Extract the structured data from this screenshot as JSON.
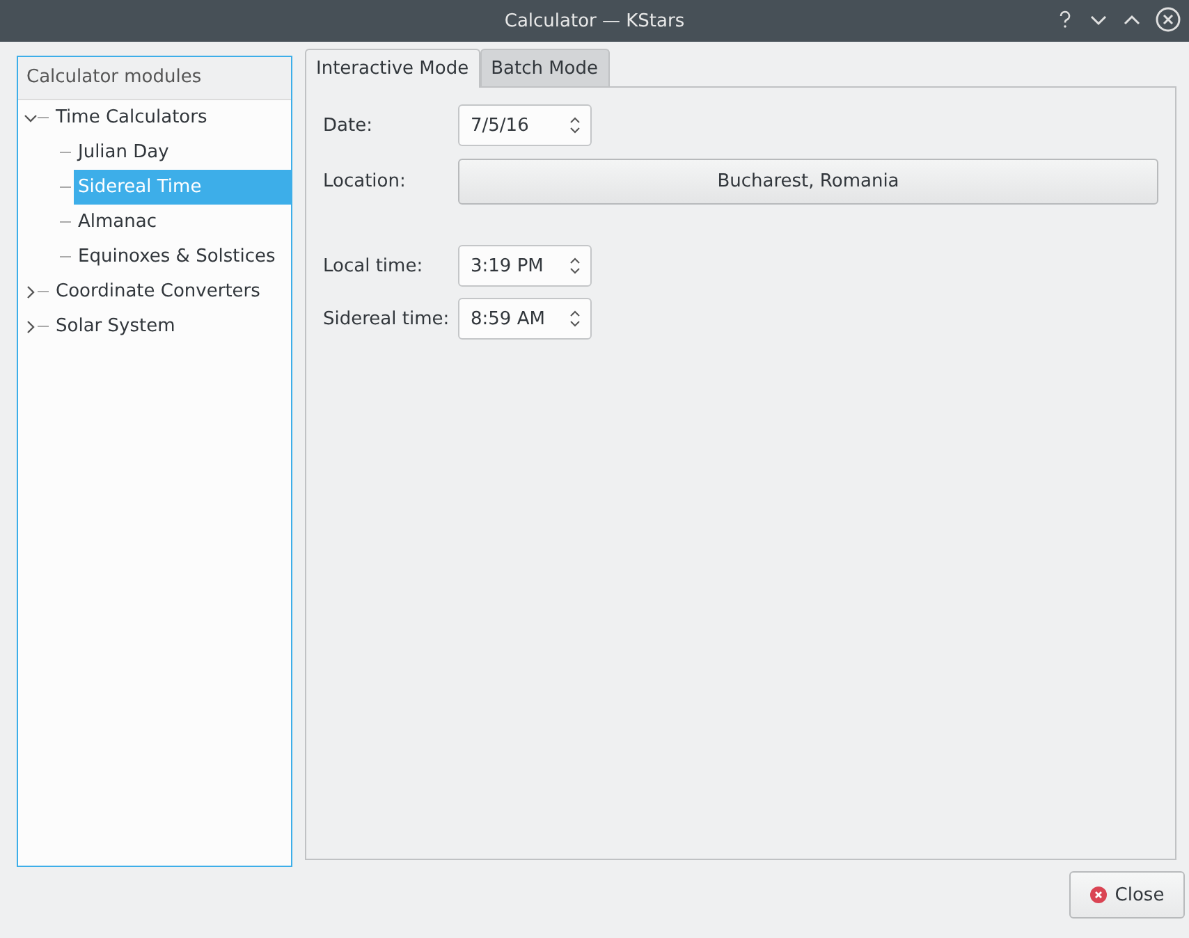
{
  "window": {
    "title": "Calculator — KStars"
  },
  "tree": {
    "header": "Calculator modules",
    "items": [
      {
        "label": "Time Calculators",
        "expanded": true,
        "selected": false,
        "children": [
          {
            "label": "Julian Day",
            "selected": false
          },
          {
            "label": "Sidereal Time",
            "selected": true
          },
          {
            "label": "Almanac",
            "selected": false
          },
          {
            "label": "Equinoxes & Solstices",
            "selected": false
          }
        ]
      },
      {
        "label": "Coordinate Converters",
        "expanded": false,
        "selected": false
      },
      {
        "label": "Solar System",
        "expanded": false,
        "selected": false
      }
    ]
  },
  "tabs": [
    {
      "label": "Interactive Mode",
      "selected": true
    },
    {
      "label": "Batch Mode",
      "selected": false
    }
  ],
  "fields": [
    {
      "label": "Date:",
      "kind": "spinbox",
      "value": "7/5/16"
    },
    {
      "label": "Location:",
      "kind": "button",
      "value": "Bucharest, Romania"
    }
  ],
  "time_fields": [
    {
      "label": "Local time:",
      "kind": "spinbox",
      "value": "3:19 PM"
    },
    {
      "label": "Sidereal time:",
      "kind": "spinbox",
      "value": "8:59 AM"
    }
  ],
  "buttons": [
    {
      "label": "Close"
    }
  ]
}
